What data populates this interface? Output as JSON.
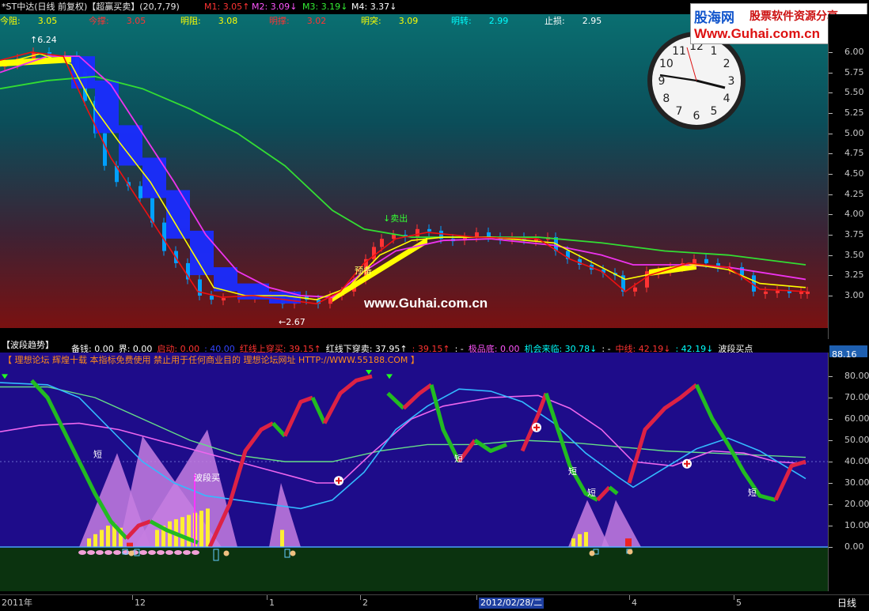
{
  "header": {
    "title": "*ST中达(日线 前复权)【超赢买卖】(20,7,79)",
    "m1": "M1: 3.05",
    "m1_arrow": "↑",
    "m2": "M2: 3.09",
    "m2_arrow": "↓",
    "m3": "M3: 3.19",
    "m3_arrow": "↓",
    "m4": "M4: 3.37",
    "m4_arrow": "↓"
  },
  "levels": [
    {
      "label": "今阻:",
      "value": "3.05",
      "color": "#ffff00"
    },
    {
      "label": "今撑:",
      "value": "3.05",
      "color": "#ff3333"
    },
    {
      "label": "明阻:",
      "value": "3.08",
      "color": "#ffff00"
    },
    {
      "label": "明撑:",
      "value": "3.02",
      "color": "#ff3333"
    },
    {
      "label": "明突:",
      "value": "3.09",
      "color": "#ffff00"
    },
    {
      "label": "明转:",
      "value": "2.99",
      "color": "#00ffff"
    },
    {
      "label": "止损:",
      "value": "2.95",
      "color": "#ffffff"
    }
  ],
  "upper": {
    "high_label": "6.24",
    "low_label": "2.67",
    "sell_label": "卖出",
    "warn_label": "预备",
    "watermark": "www.Guhai.com.cn",
    "y_ticks": [
      "6.00",
      "5.75",
      "5.50",
      "5.25",
      "5.00",
      "4.75",
      "4.50",
      "4.25",
      "4.00",
      "3.75",
      "3.50",
      "3.25",
      "3.00"
    ]
  },
  "lower_title": {
    "name": "【波段趋势】",
    "items": [
      {
        "text": "备钱: 0.00",
        "color": "#ffffff"
      },
      {
        "text": "界: 0.00",
        "color": "#ffffff"
      },
      {
        "text": "启动: 0.00",
        "color": "#ff3333"
      },
      {
        "text": ": 40.00",
        "color": "#3344ff"
      },
      {
        "text": "红线上穿买: 39.15↑",
        "color": "#ff3333"
      },
      {
        "text": "红线下穿卖: 37.95↑",
        "color": "#ffffff"
      },
      {
        "text": ": 39.15↑",
        "color": "#ff3333"
      },
      {
        "text": ": -",
        "color": "#ffffff"
      },
      {
        "text": "极品底: 0.00",
        "color": "#ff55ff"
      },
      {
        "text": "机会来临: 30.78↓",
        "color": "#00ffff"
      },
      {
        "text": ": -",
        "color": "#ffffff"
      },
      {
        "text": "中线: 42.19↓",
        "color": "#ff3333"
      },
      {
        "text": ": 42.19↓",
        "color": "#00ffff"
      },
      {
        "text": "波段买点",
        "color": "#ffffff"
      }
    ]
  },
  "notice": "【 理想论坛  辉煌十载  本指标免费使用  禁止用于任何商业目的  理想论坛网址 HTTP://WWW.55188.COM 】",
  "lower": {
    "current_value": "88.16",
    "short_label": "短",
    "wave_buy_label": "波段买",
    "y_ticks": [
      "80.00",
      "70.00",
      "60.00",
      "50.00",
      "40.00",
      "30.00",
      "20.00",
      "10.00",
      "0.00"
    ]
  },
  "bottom": {
    "dates": [
      {
        "label": "2011年",
        "highlight": false
      },
      {
        "label": "12",
        "highlight": false
      },
      {
        "label": "1",
        "highlight": false
      },
      {
        "label": "2",
        "highlight": false
      },
      {
        "label": "2012/02/28/二",
        "highlight": true
      },
      {
        "label": "4",
        "highlight": false
      },
      {
        "label": "5",
        "highlight": false
      }
    ],
    "period": "日线"
  },
  "site_badge": {
    "logo": "股海网",
    "slogan": "股票软件资源分享",
    "url": "Www.Guhai.com.cn"
  },
  "clock": {
    "numbers": [
      "12",
      "1",
      "2",
      "3",
      "4",
      "5",
      "6",
      "7",
      "8",
      "9",
      "10",
      "11"
    ]
  },
  "colors": {
    "candle_up": "#ff3333",
    "candle_down": "#00a0ff",
    "ma_green": "#33dd33",
    "ma_magenta": "#ee33ee",
    "ma_yellow": "#ffff00",
    "ma_red": "#ee1111"
  }
}
